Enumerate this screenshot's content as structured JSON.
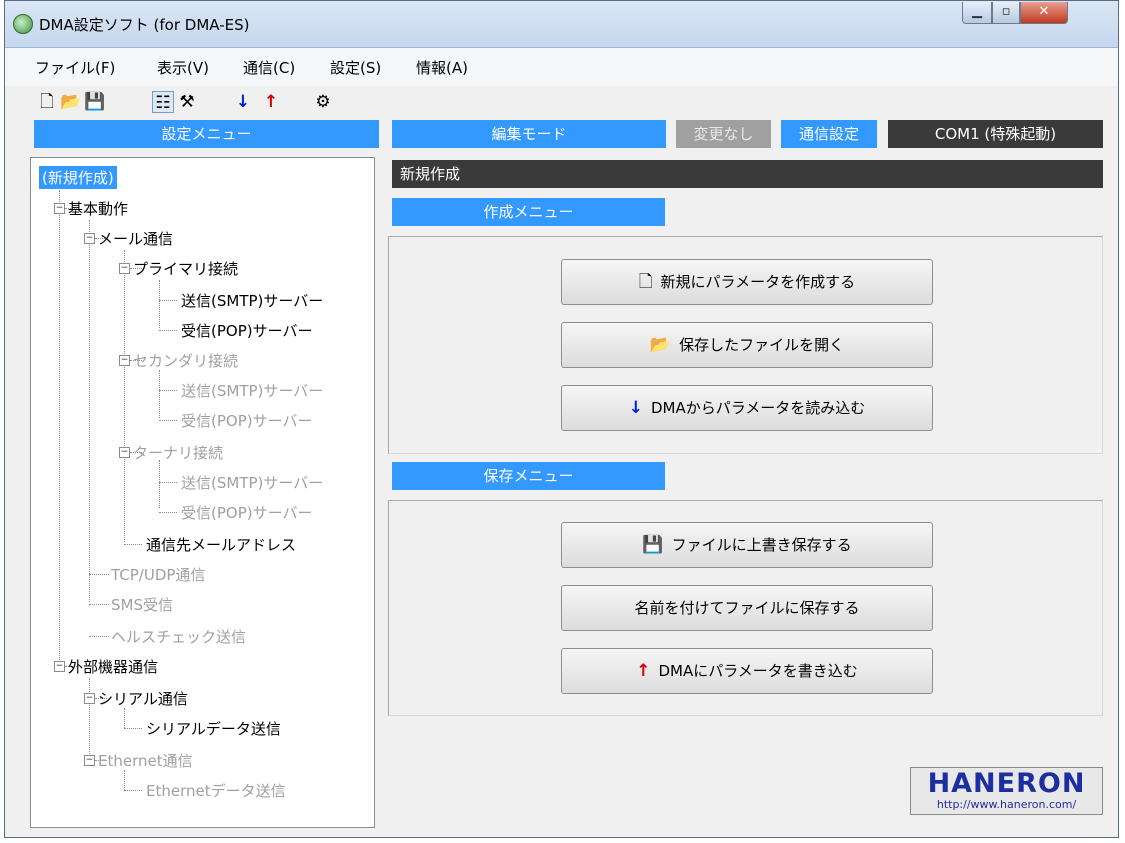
{
  "window": {
    "title": "DMA設定ソフト (for DMA-ES)"
  },
  "menu": [
    "ファイル(F)",
    "表示(V)",
    "通信(C)",
    "設定(S)",
    "情報(A)"
  ],
  "toolbar": {
    "icons": [
      "new-file-icon",
      "open-folder-icon",
      "save-icon",
      "tree-view-icon",
      "tools-icon",
      "download-arrow-icon",
      "upload-arrow-icon",
      "settings-gear-icon"
    ]
  },
  "left_header": "設定メニュー",
  "tree": {
    "root_selected": "(新規作成)",
    "basic": "基本動作",
    "mail": "メール通信",
    "primary": "プライマリ接続",
    "primary_smtp": "送信(SMTP)サーバー",
    "primary_pop": "受信(POP)サーバー",
    "secondary": "セカンダリ接続",
    "secondary_smtp": "送信(SMTP)サーバー",
    "secondary_pop": "受信(POP)サーバー",
    "ternary": "ターナリ接続",
    "ternary_smtp": "送信(SMTP)サーバー",
    "ternary_pop": "受信(POP)サーバー",
    "mail_address": "通信先メールアドレス",
    "tcp_udp": "TCP/UDP通信",
    "sms": "SMS受信",
    "health": "ヘルスチェック送信",
    "external": "外部機器通信",
    "serial": "シリアル通信",
    "serial_send": "シリアルデータ送信",
    "ethernet": "Ethernet通信",
    "ethernet_send": "Ethernetデータ送信"
  },
  "status": {
    "mode": "編集モード",
    "changed": "変更なし",
    "comm_settings": "通信設定",
    "port": "COM1 (特殊起動)"
  },
  "page_title": "新規作成",
  "create_menu": {
    "header": "作成メニュー",
    "new": "新規にパラメータを作成する",
    "open": "保存したファイルを開く",
    "read": "DMAからパラメータを読み込む"
  },
  "save_menu": {
    "header": "保存メニュー",
    "overwrite": "ファイルに上書き保存する",
    "save_as": "名前を付けてファイルに保存する",
    "write": "DMAにパラメータを書き込む"
  },
  "logo": {
    "text": "HANERON",
    "url": "http://www.haneron.com/"
  },
  "colors": {
    "accent": "#3399ff",
    "dark": "#3a3a3a",
    "disabled": "#a0a0a0",
    "logo": "#1d2fa0"
  }
}
